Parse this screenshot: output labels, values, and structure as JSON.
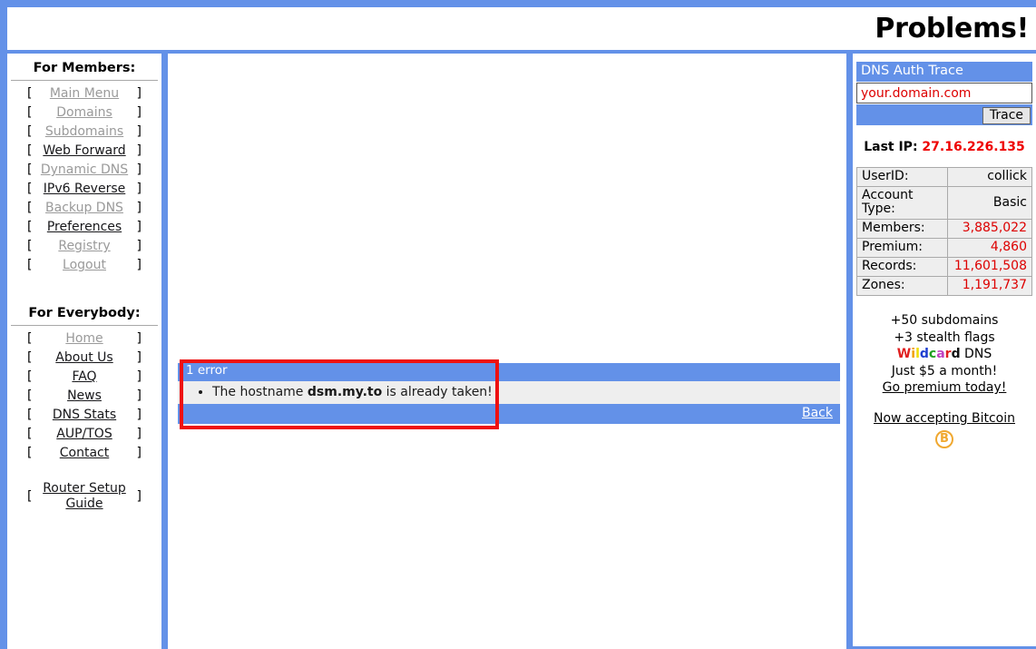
{
  "header": {
    "title": "Problems!"
  },
  "colors": {
    "page_background": "#6391e8",
    "panel": "#ffffff",
    "accent_blue": "#6391e8",
    "error_outline": "#ee1111",
    "stat_value_red": "#dd0000",
    "visited_link": "#9a9a9a"
  },
  "sidebar": {
    "members_heading": "For Members:",
    "members_items": [
      {
        "label": "Main Menu",
        "state": "visited"
      },
      {
        "label": "Domains",
        "state": "visited"
      },
      {
        "label": "Subdomains",
        "state": "visited"
      },
      {
        "label": "Web Forward",
        "state": "active"
      },
      {
        "label": "Dynamic DNS",
        "state": "visited"
      },
      {
        "label": "IPv6 Reverse",
        "state": "active"
      },
      {
        "label": "Backup DNS",
        "state": "visited"
      },
      {
        "label": "Preferences",
        "state": "active"
      },
      {
        "label": "Registry",
        "state": "visited"
      },
      {
        "label": "Logout",
        "state": "visited"
      }
    ],
    "everybody_heading": "For Everybody:",
    "everybody_items": [
      {
        "label": "Home",
        "state": "visited"
      },
      {
        "label": "About Us",
        "state": "active"
      },
      {
        "label": "FAQ",
        "state": "active"
      },
      {
        "label": "News",
        "state": "active"
      },
      {
        "label": "DNS Stats",
        "state": "active"
      },
      {
        "label": "AUP/TOS",
        "state": "active"
      },
      {
        "label": "Contact",
        "state": "active"
      }
    ],
    "extra_items": [
      {
        "label": "Router Setup Guide",
        "state": "active"
      }
    ],
    "bracket_open": "[",
    "bracket_close": "]"
  },
  "main": {
    "error_panel": {
      "title": "1 error",
      "messages": [
        {
          "prefix": "The hostname ",
          "hostname": "dsm.my.to",
          "suffix": " is already taken!"
        }
      ],
      "back_label": "Back"
    }
  },
  "right": {
    "trace": {
      "heading": "DNS Auth Trace",
      "input_value": "your.domain.com",
      "input_placeholder": "your.domain.com",
      "button_label": "Trace"
    },
    "last_ip": {
      "label": "Last IP:",
      "value": "27.16.226.135"
    },
    "stats": [
      {
        "label": "UserID:",
        "value": "collick",
        "red": false
      },
      {
        "label": "Account Type:",
        "value": "Basic",
        "red": false
      },
      {
        "label": "Members:",
        "value": "3,885,022",
        "red": true
      },
      {
        "label": "Premium:",
        "value": "4,860",
        "red": true
      },
      {
        "label": "Records:",
        "value": "11,601,508",
        "red": true
      },
      {
        "label": "Zones:",
        "value": "1,191,737",
        "red": true
      }
    ],
    "promo": {
      "line1": "+50 subdomains",
      "line2": "+3 stealth flags",
      "wildcard_letters": [
        "W",
        "i",
        "l",
        "d",
        "c",
        "a",
        "r",
        "d"
      ],
      "wildcard_suffix": " DNS",
      "line4": "Just $5 a month!",
      "premium_link": "Go premium today!",
      "bitcoin_link": "Now accepting Bitcoin",
      "bitcoin_glyph": "B"
    }
  }
}
